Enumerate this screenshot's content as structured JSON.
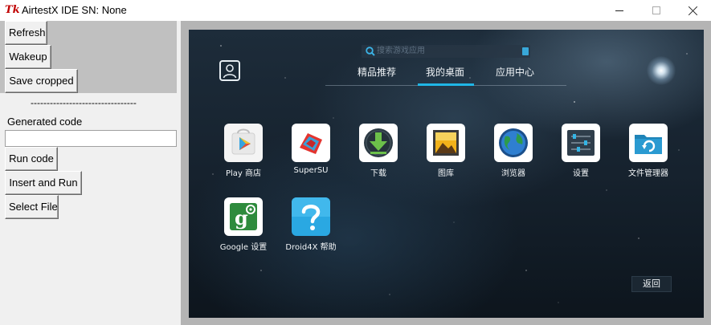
{
  "window": {
    "title": "AirtestX IDE SN: None",
    "icon_text": "Tk"
  },
  "left_panel": {
    "buttons": {
      "refresh": "Refresh",
      "wakeup": "Wakeup",
      "save_cropped": "Save cropped",
      "run_code": "Run code",
      "insert_and_run": "Insert and Run",
      "select_file": "Select File"
    },
    "separator": "---------------------------------",
    "generated_code_label": "Generated code",
    "generated_code_value": ""
  },
  "device": {
    "search_placeholder": "搜索游戏应用",
    "tabs": [
      "精品推荐",
      "我的桌面",
      "应用中心"
    ],
    "active_tab": "我的桌面",
    "apps": [
      {
        "label": "Play 商店",
        "icon": "play-store-icon"
      },
      {
        "label": "SuperSU",
        "icon": "supersu-icon"
      },
      {
        "label": "下载",
        "icon": "download-icon"
      },
      {
        "label": "图库",
        "icon": "gallery-icon"
      },
      {
        "label": "浏览器",
        "icon": "browser-icon"
      },
      {
        "label": "设置",
        "icon": "settings-icon"
      },
      {
        "label": "文件管理器",
        "icon": "file-manager-icon"
      },
      {
        "label": "Google 设置",
        "icon": "google-settings-icon"
      },
      {
        "label": "Droid4X 帮助",
        "icon": "droid4x-help-icon"
      }
    ],
    "back_label": "返回",
    "colors": {
      "accent": "#1fb6e6",
      "frame_gray": "#b4b4b4",
      "panel_gray": "#c0c0c0"
    }
  }
}
